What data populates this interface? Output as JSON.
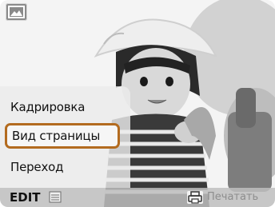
{
  "menu": {
    "items": [
      {
        "label": "Кадрировка",
        "selected": false
      },
      {
        "label": "Вид страницы",
        "selected": true
      },
      {
        "label": "Переход",
        "selected": false
      }
    ],
    "highlight_color": "#b36b1f"
  },
  "bottom_bar": {
    "edit_label": "EDIT",
    "list_icon": "list-icon",
    "print_icon": "print-icon",
    "print_label": "Печатать"
  },
  "corner_icon": "image-icon"
}
